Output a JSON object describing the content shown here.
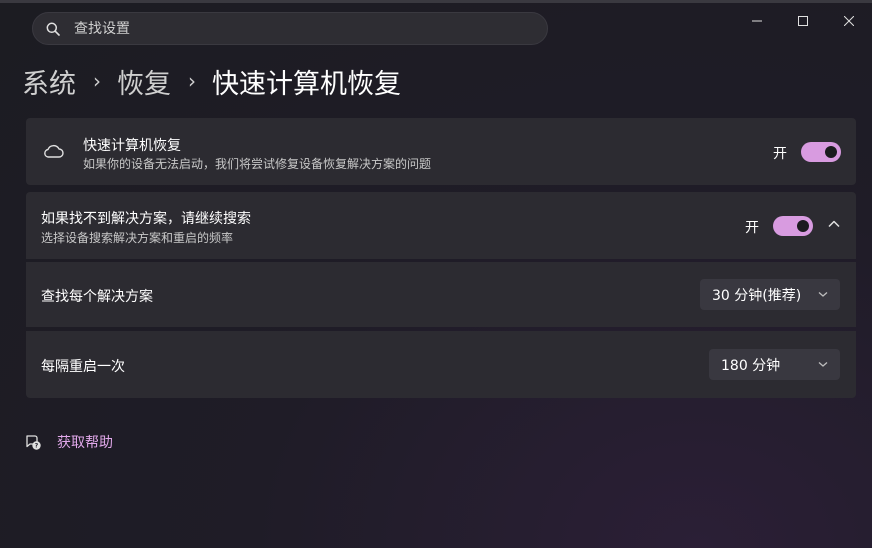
{
  "search": {
    "placeholder": "查找设置"
  },
  "breadcrumb": {
    "items": [
      "系统",
      "恢复",
      "快速计算机恢复"
    ]
  },
  "quick_recovery": {
    "title": "快速计算机恢复",
    "description": "如果你的设备无法启动，我们将尝试修复设备恢复解决方案的问题",
    "toggle_label": "开",
    "toggle_on": true
  },
  "continue_search": {
    "title": "如果找不到解决方案，请继续搜索",
    "description": "选择设备搜索解决方案和重启的频率",
    "toggle_label": "开",
    "toggle_on": true,
    "expanded": true
  },
  "find_each": {
    "label": "查找每个解决方案",
    "value": "30 分钟(推荐)"
  },
  "restart_every": {
    "label": "每隔重启一次",
    "value": "180 分钟"
  },
  "help": {
    "label": "获取帮助"
  },
  "colors": {
    "accent": "#d89be0",
    "link": "#e1a8ea",
    "card": "#2c2b31"
  },
  "icons": [
    "search-icon",
    "cloud-icon",
    "chevron-up-icon",
    "chevron-down-icon",
    "help-icon",
    "minimize-icon",
    "maximize-icon",
    "close-icon"
  ]
}
